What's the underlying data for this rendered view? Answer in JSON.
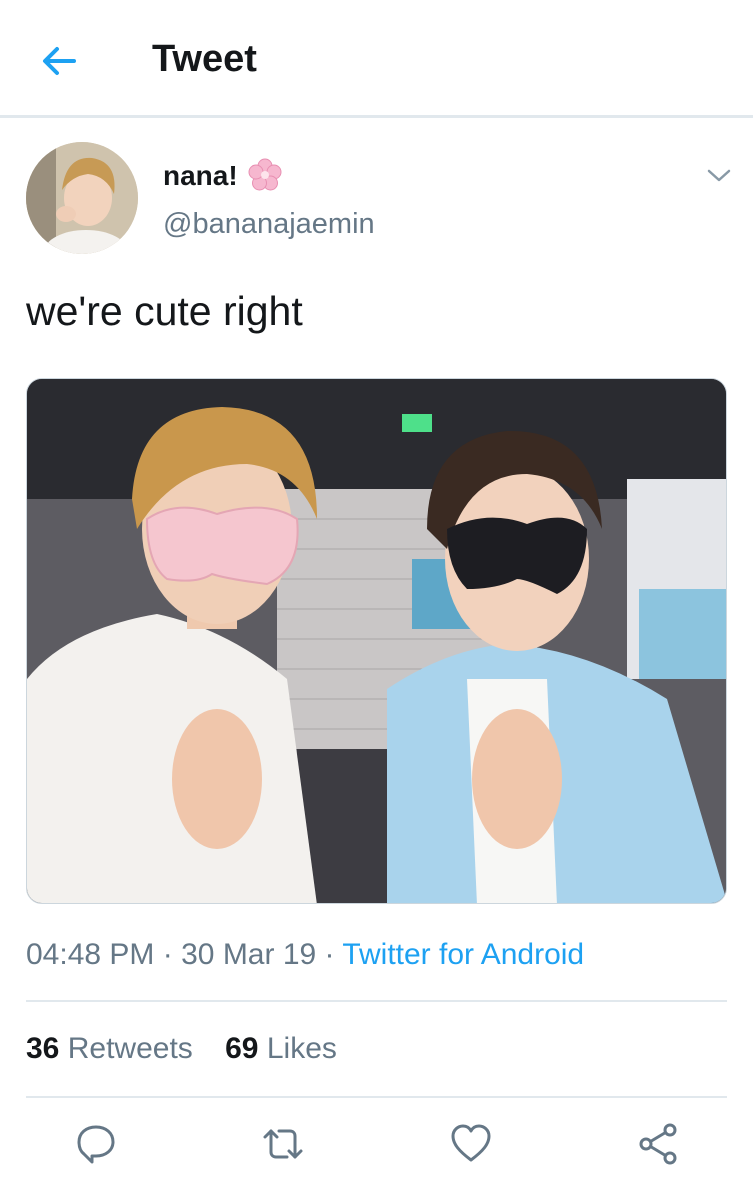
{
  "header": {
    "title": "Tweet"
  },
  "tweet": {
    "author": {
      "display_name": "nana!",
      "handle": "@bananajaemin"
    },
    "text": "we're cute right",
    "time": "04:48 PM",
    "separator": "·",
    "date": "30 Mar 19",
    "source": "Twitter for Android",
    "stats": {
      "retweets_count": "36",
      "retweets_label": "Retweets",
      "likes_count": "69",
      "likes_label": "Likes"
    }
  },
  "colors": {
    "accent": "#1da1f2",
    "text": "#14171a",
    "muted": "#657786",
    "divider": "#e1e8ed"
  },
  "icons": [
    "back-arrow-icon",
    "flower-icon",
    "chevron-down-icon",
    "reply-icon",
    "retweet-icon",
    "like-icon",
    "share-icon"
  ]
}
